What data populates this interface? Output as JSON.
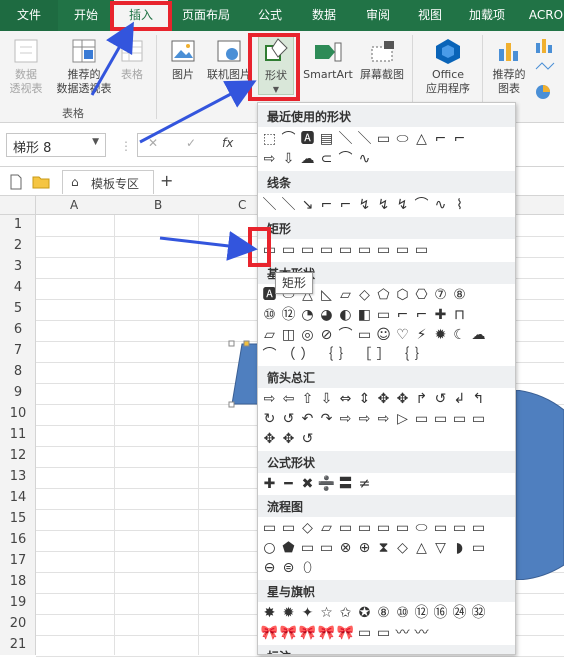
{
  "tabs": [
    "文件",
    "开始",
    "插入",
    "页面布局",
    "公式",
    "数据",
    "审阅",
    "视图",
    "加载项",
    "ACRO"
  ],
  "ribbon": {
    "pivot": "数据\n透视表",
    "recommended_pivot": "推荐的\n数据透视表",
    "table": "表格",
    "picture": "图片",
    "online_picture": "联机图片",
    "shapes": "形状",
    "smartart": "SmartArt",
    "screenshot": "屏幕截图",
    "office_apps": "Office\n应用程序",
    "recommended_charts": "推荐的\n图表",
    "group_tables": "表格"
  },
  "formula_bar": {
    "name_box": "梯形 8",
    "fx": "fx"
  },
  "workbook_tabs": {
    "template_zone": "模板专区",
    "add": "+"
  },
  "columns": [
    "A",
    "B",
    "C"
  ],
  "rows": [
    "1",
    "2",
    "3",
    "4",
    "5",
    "6",
    "7",
    "8",
    "9",
    "10",
    "11",
    "12",
    "13",
    "14",
    "15",
    "16",
    "17",
    "18",
    "19",
    "20",
    "21"
  ],
  "shapes_menu": {
    "sections": [
      "最近使用的形状",
      "线条",
      "矩形",
      "基本形状",
      "箭头总汇",
      "公式形状",
      "流程图",
      "星与旗帜",
      "标注"
    ],
    "tooltip": "矩形",
    "recent_row1": "⬚⌒🅰▤＼＼▭⬭△⌐⌐",
    "recent_row2": "⇨⇩☁⊂⌒∿",
    "lines_row": "＼＼↘⌐⌐↯↯↯⌒∿⌇",
    "rect_row": "▭▭▭▭▭▭▭▭▭",
    "basic_row1": "🅰⬭△◺▱◇⬠⬡⎔⑦⑧",
    "basic_row2": "⑩⑫◔◕◐◧▭⌐⌐✚⊓",
    "basic_row3": "▱◫◎⊘⌒▭☺♡⚡✹☾☁",
    "basic_row4": "⌒（）｛｝［］｛｝",
    "arrows_row1": "⇨⇦⇧⇩⇔⇕✥✥↱↺↲↰",
    "arrows_row2": "↻↺↶↷⇨⇨⇨▷▭▭▭▭",
    "arrows_row3": "✥✥↺",
    "eq_row": "✚━✖➗〓≠",
    "flow_row1": "▭▭◇▱▭▭▭▭⬭▭▭▭",
    "flow_row2": "○⬟▭▭⊗⊕⧗◇△▽◗▭",
    "flow_row3": "⊖⊜⬯",
    "stars_row1": "✸✹✦☆✩✪⑧⑩⑫⑯㉔㉜",
    "stars_row2": "🎀🎀🎀🎀🎀▭▭〰〰"
  }
}
